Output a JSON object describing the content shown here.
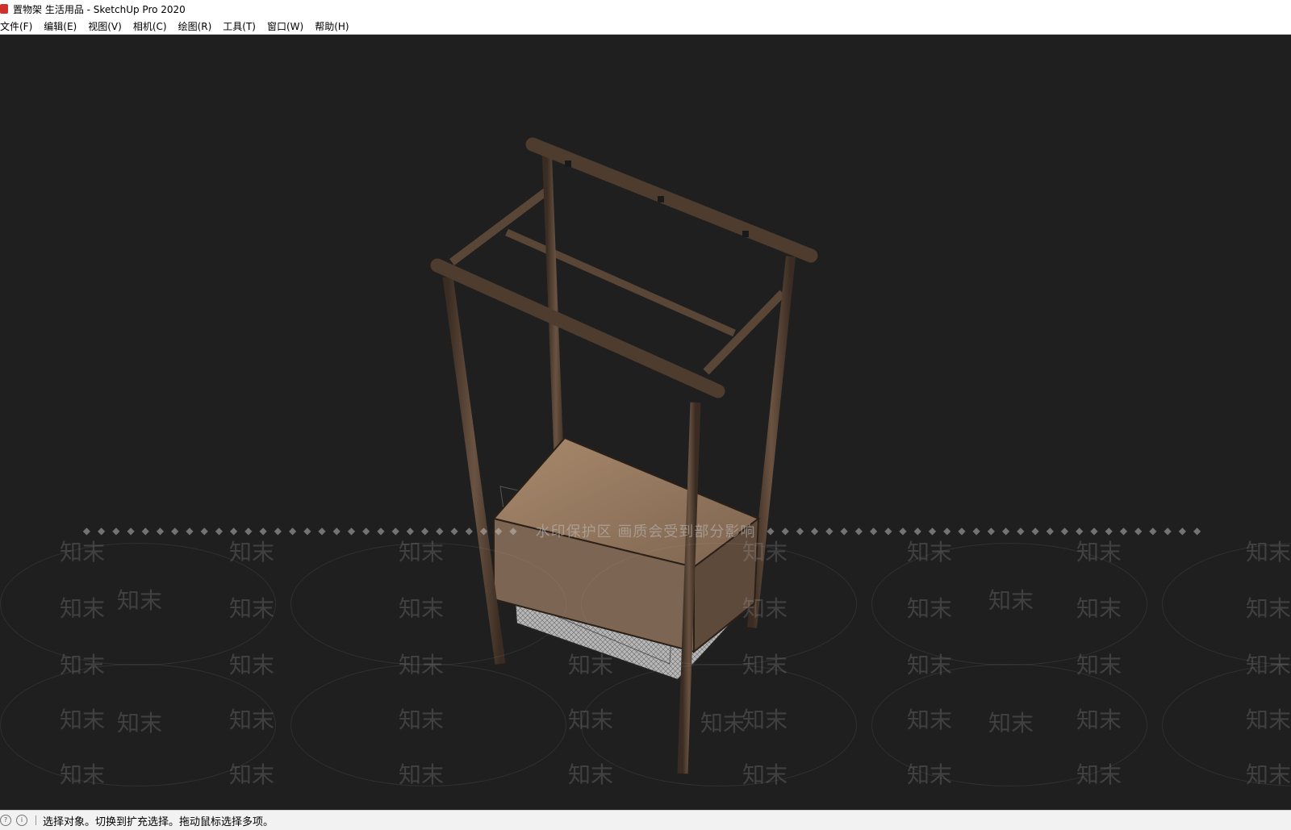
{
  "window": {
    "title": "置物架 生活用品 - SketchUp Pro 2020"
  },
  "menu": [
    {
      "label": "文件(F)"
    },
    {
      "label": "编辑(E)"
    },
    {
      "label": "视图(V)"
    },
    {
      "label": "相机(C)"
    },
    {
      "label": "绘图(R)"
    },
    {
      "label": "工具(T)"
    },
    {
      "label": "窗口(W)"
    },
    {
      "label": "帮助(H)"
    }
  ],
  "watermark": {
    "banner": "水印保护区  画质会受到部分影响",
    "tile_text": "知末"
  },
  "status": {
    "message": "选择对象。切换到扩充选择。拖动鼠标选择多项。"
  },
  "colors": {
    "viewport_bg": "#1f1f1f",
    "wood_dark": "#4a3a2e",
    "wood_light": "#8a6f58",
    "shelf_top": "#9a7a5e"
  }
}
